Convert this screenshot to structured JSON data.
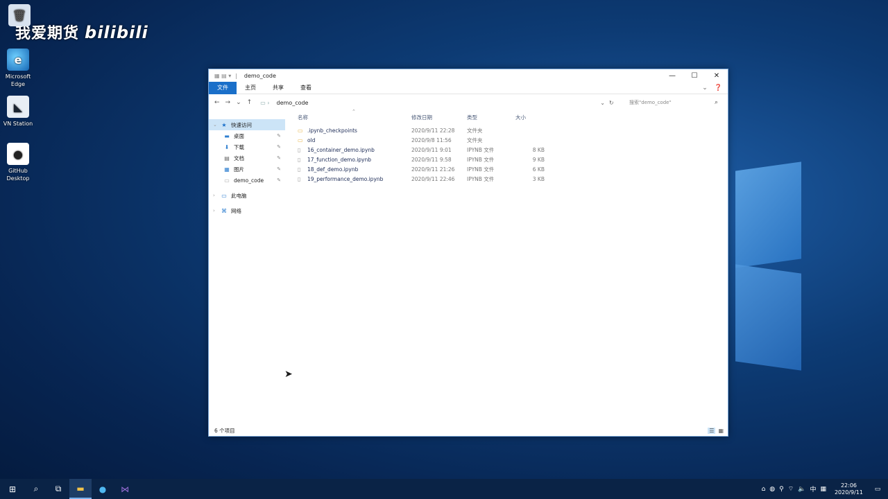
{
  "desktop": {
    "watermark_cn": "我爱期货",
    "watermark_bili": "bilibili",
    "icons": [
      {
        "label": "",
        "icon": "recycle-bin-icon"
      },
      {
        "label": "Microsoft Edge",
        "icon": "edge-icon"
      },
      {
        "label": "VN Station",
        "icon": "vn-station-icon"
      },
      {
        "label": "GitHub Desktop",
        "icon": "github-desktop-icon"
      }
    ]
  },
  "window": {
    "title": "demo_code",
    "controls": {
      "minimize": "—",
      "maximize": "☐",
      "close": "✕"
    },
    "ribbon_tabs": [
      "文件",
      "主页",
      "共享",
      "查看"
    ],
    "address": {
      "path": "demo_code",
      "refresh": "↻",
      "dropdown": "⌄"
    },
    "search": {
      "placeholder": "搜索\"demo_code\""
    }
  },
  "sidebar": {
    "items": [
      {
        "label": "快速访问",
        "icon": "star-icon"
      },
      {
        "label": "桌面",
        "icon": "desktop-folder-icon"
      },
      {
        "label": "下载",
        "icon": "download-folder-icon"
      },
      {
        "label": "文档",
        "icon": "documents-folder-icon"
      },
      {
        "label": "图片",
        "icon": "pictures-folder-icon"
      },
      {
        "label": "demo_code",
        "icon": "folder-icon"
      },
      {
        "label": "此电脑",
        "icon": "computer-icon"
      },
      {
        "label": "网络",
        "icon": "network-icon"
      }
    ]
  },
  "file_list": {
    "columns": [
      "名称",
      "修改日期",
      "类型",
      "大小"
    ],
    "rows": [
      {
        "name": ".ipynb_checkpoints",
        "date": "2020/9/11 22:28",
        "type": "文件夹",
        "size": "",
        "kind": "folder"
      },
      {
        "name": "old",
        "date": "2020/9/8 11:56",
        "type": "文件夹",
        "size": "",
        "kind": "folder"
      },
      {
        "name": "16_container_demo.ipynb",
        "date": "2020/9/11 9:01",
        "type": "IPYNB 文件",
        "size": "8 KB",
        "kind": "file"
      },
      {
        "name": "17_function_demo.ipynb",
        "date": "2020/9/11 9:58",
        "type": "IPYNB 文件",
        "size": "9 KB",
        "kind": "file"
      },
      {
        "name": "18_def_demo.ipynb",
        "date": "2020/9/11 21:26",
        "type": "IPYNB 文件",
        "size": "6 KB",
        "kind": "file"
      },
      {
        "name": "19_performance_demo.ipynb",
        "date": "2020/9/11 22:46",
        "type": "IPYNB 文件",
        "size": "3 KB",
        "kind": "file"
      }
    ]
  },
  "statusbar": {
    "count": "6 个项目"
  },
  "taskbar": {
    "time": "22:06",
    "date": "2020/9/11",
    "ime": "中"
  }
}
